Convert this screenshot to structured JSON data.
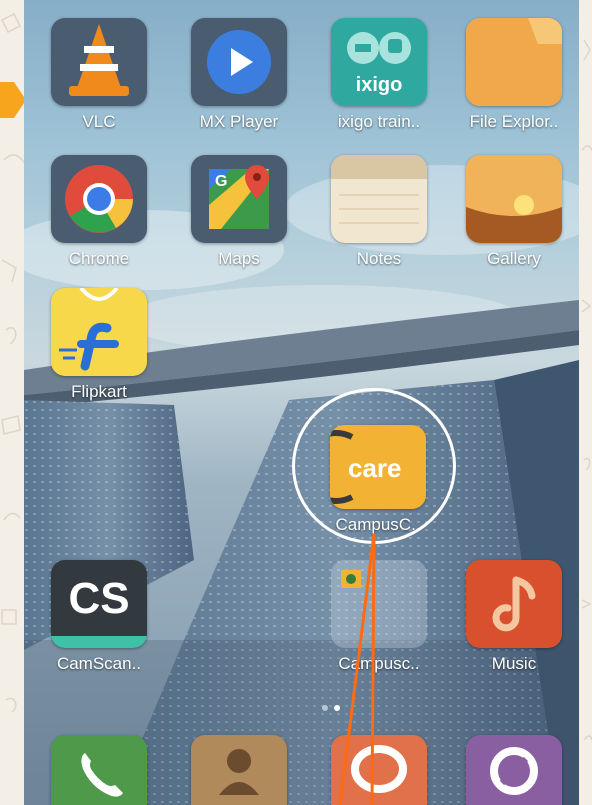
{
  "home_screen": {
    "row1": [
      {
        "label": "VLC",
        "icon": "vlc-icon"
      },
      {
        "label": "MX Player",
        "icon": "mx-player-icon"
      },
      {
        "label": "ixigo train..",
        "icon": "ixigo-icon",
        "icon_text": "ixigo"
      },
      {
        "label": "File Explor..",
        "icon": "folder-icon"
      }
    ],
    "row2": [
      {
        "label": "Chrome",
        "icon": "chrome-icon"
      },
      {
        "label": "Maps",
        "icon": "maps-icon",
        "icon_text": "G"
      },
      {
        "label": "Notes",
        "icon": "notes-icon"
      },
      {
        "label": "Gallery",
        "icon": "gallery-icon"
      }
    ],
    "row3": [
      {
        "label": "Flipkart",
        "icon": "flipkart-icon"
      }
    ],
    "highlighted_app": {
      "label": "CampusC..",
      "icon": "campus-care-icon",
      "icon_text": "care"
    },
    "row5": [
      {
        "label": "CamScan..",
        "icon": "camscanner-icon",
        "icon_text": "CS"
      },
      {
        "label": "Campusc..",
        "icon": "campus-folder-icon"
      },
      {
        "label": "Music",
        "icon": "music-icon"
      }
    ],
    "dock": [
      {
        "icon": "phone-icon"
      },
      {
        "icon": "contacts-icon"
      },
      {
        "icon": "messaging-icon"
      },
      {
        "icon": "browser-icon"
      }
    ]
  },
  "colors": {
    "highlight_circle": "#ffffff",
    "pointer_line": "#ff6a13",
    "arrow_tab": "#f7a51d"
  }
}
